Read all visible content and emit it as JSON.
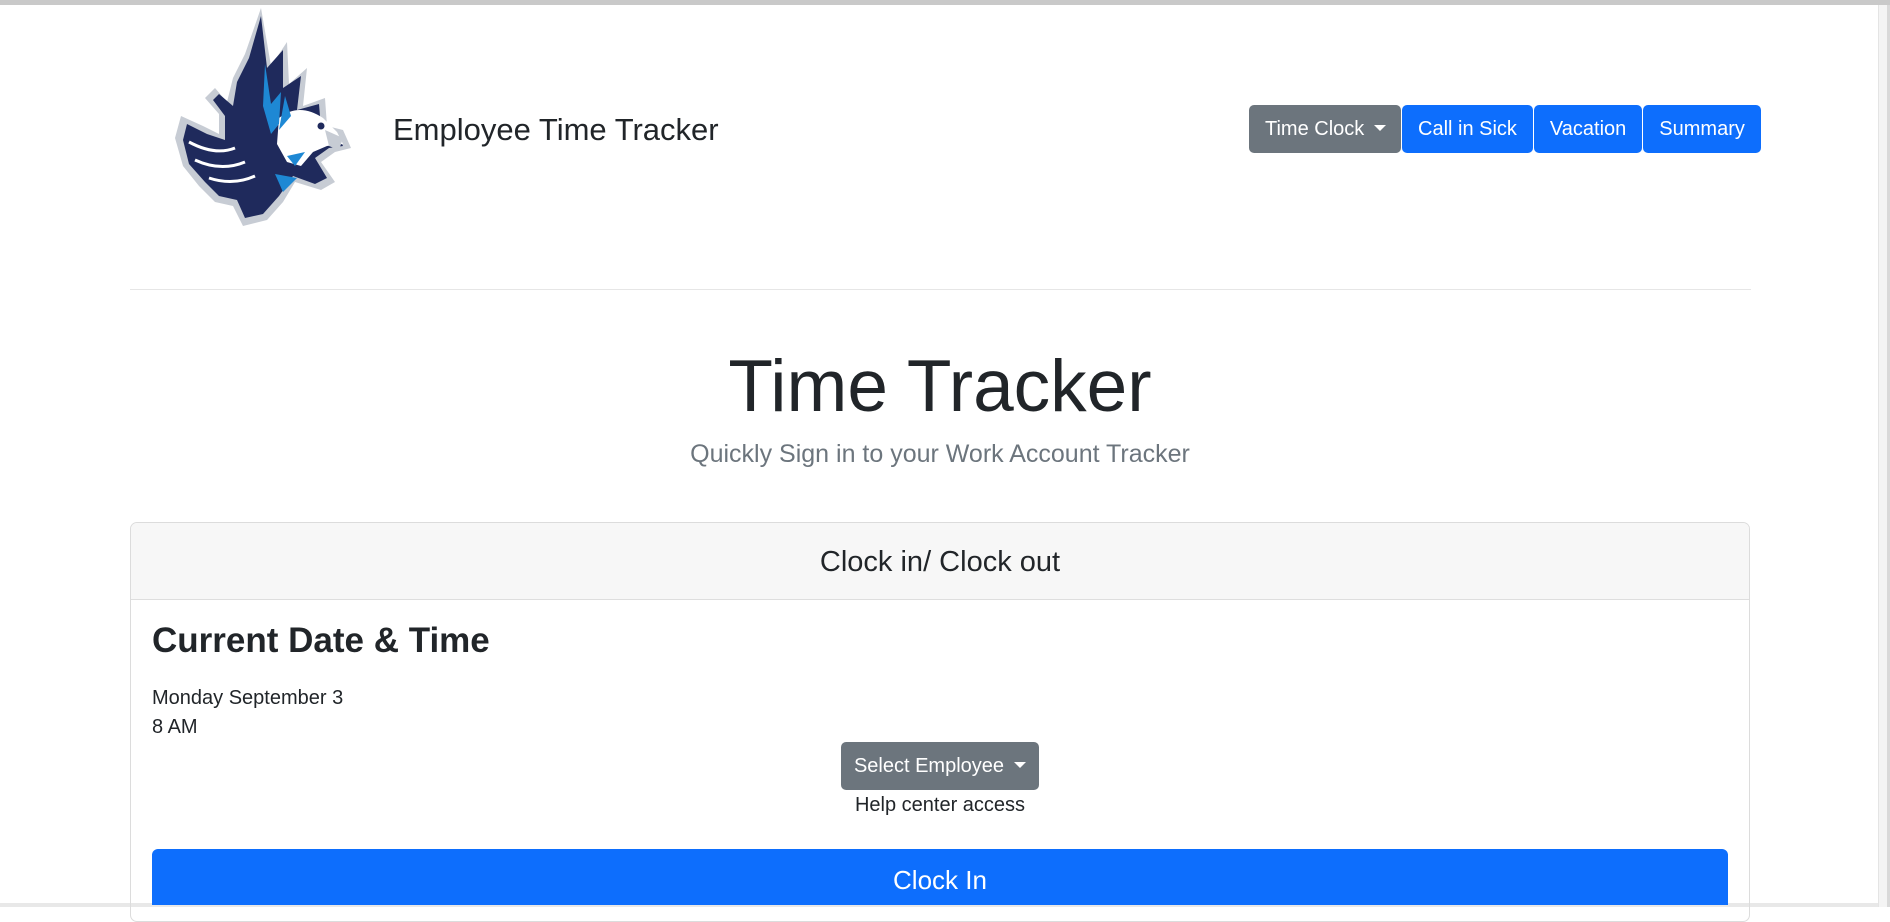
{
  "header": {
    "logo_icon": "eagle-mascot-logo",
    "brand_title": "Employee Time Tracker"
  },
  "nav": {
    "items": [
      {
        "label": "Time Clock",
        "style": "secondary",
        "has_dropdown": true
      },
      {
        "label": "Call in Sick",
        "style": "primary"
      },
      {
        "label": "Vacation",
        "style": "primary"
      },
      {
        "label": "Summary",
        "style": "primary"
      }
    ]
  },
  "hero": {
    "title": "Time Tracker",
    "subtitle": "Quickly Sign in to your Work Account Tracker"
  },
  "card": {
    "header": "Clock in/ Clock out",
    "section_title": "Current Date & Time",
    "date": "Monday September 3",
    "time": "8 AM",
    "select_employee_label": "Select Employee",
    "help_text": "Help center access",
    "clock_in_label": "Clock In"
  },
  "colors": {
    "primary": "#0d6efd",
    "secondary": "#6c757d",
    "logo_navy": "#1f2a5c",
    "logo_blue": "#1e88d4"
  }
}
